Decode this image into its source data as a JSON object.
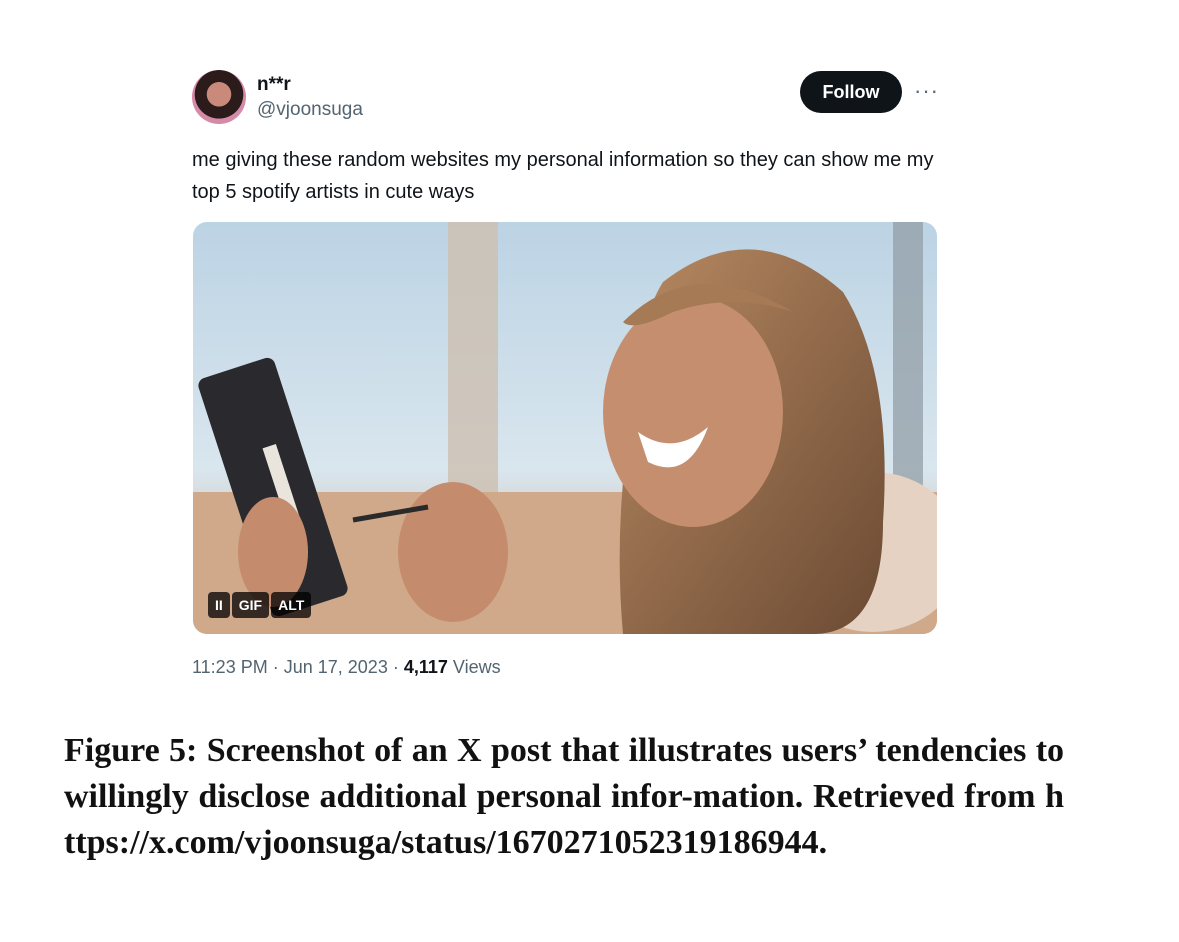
{
  "post": {
    "author_name": "n**r",
    "author_handle": "@vjoonsuga",
    "follow_label": "Follow",
    "more_label": "···",
    "text": "me giving these random websites my personal information so they can show me my top 5 spotify artists in cute ways",
    "media_controls": {
      "pause_label": "II",
      "gif_label": "GIF",
      "alt_label": "ALT"
    },
    "time": "11:23 PM",
    "date": "Jun 17, 2023",
    "views_count": "4,117",
    "views_label": "Views"
  },
  "caption": {
    "label": "Figure 5:",
    "text": "Screenshot of an X post that illustrates users’ tendencies to willingly disclose additional personal infor-mation.",
    "retrieved": "Retrieved from",
    "url": "https://x.com/vjoonsuga/status/1670271052319186944."
  }
}
